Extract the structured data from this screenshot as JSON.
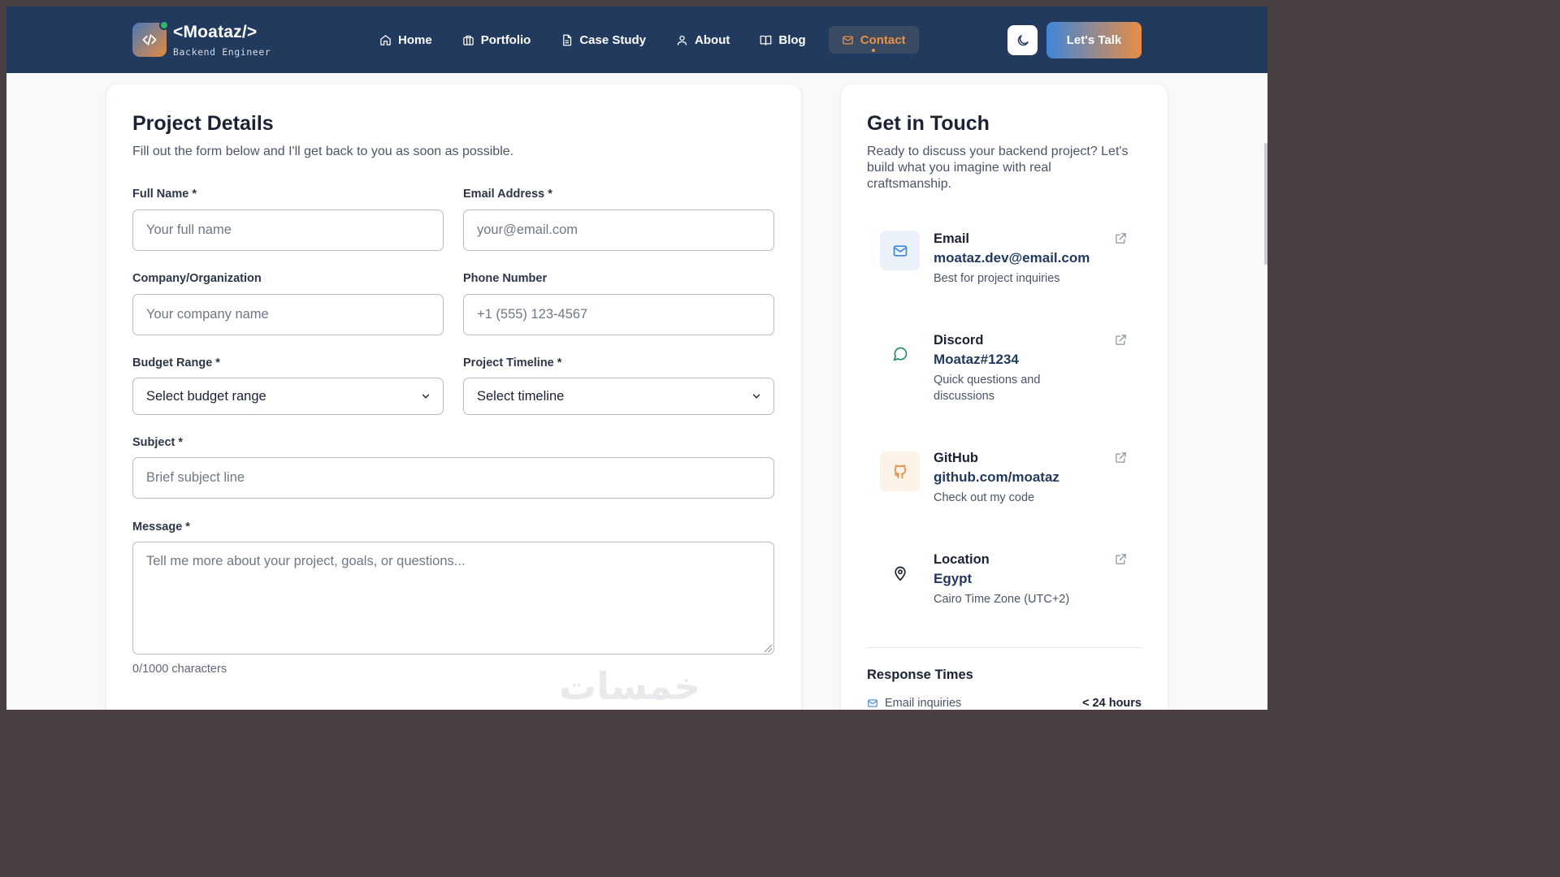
{
  "nav": {
    "logo_title": "<Moataz/>",
    "logo_subtitle": "Backend Engineer",
    "links": [
      {
        "label": "Home",
        "icon": "home-icon"
      },
      {
        "label": "Portfolio",
        "icon": "briefcase-icon"
      },
      {
        "label": "Case Study",
        "icon": "document-icon"
      },
      {
        "label": "About",
        "icon": "user-icon"
      },
      {
        "label": "Blog",
        "icon": "book-icon"
      },
      {
        "label": "Contact",
        "icon": "mail-icon",
        "active": true
      }
    ],
    "cta_label": "Let's Talk",
    "accent": "#e99247",
    "nav_bg": "#223a5e"
  },
  "form": {
    "title": "Project Details",
    "subtitle": "Fill out the form below and I'll get back to you as soon as possible.",
    "full_name_label": "Full Name *",
    "full_name_placeholder": "Your full name",
    "email_label": "Email Address *",
    "email_placeholder": "your@email.com",
    "company_label": "Company/Organization",
    "company_placeholder": "Your company name",
    "phone_label": "Phone Number",
    "phone_placeholder": "+1 (555) 123-4567",
    "budget_label": "Budget Range *",
    "budget_value": "Select budget range",
    "timeline_label": "Project Timeline *",
    "timeline_value": "Select timeline",
    "subject_label": "Subject *",
    "subject_placeholder": "Brief subject line",
    "message_label": "Message *",
    "message_placeholder": "Tell me more about your project, goals, or questions...",
    "counter": "0/1000 characters"
  },
  "touch": {
    "title": "Get in Touch",
    "subtitle": "Ready to discuss your backend project? Let's build what you imagine with real craftsmanship.",
    "items": [
      {
        "title": "Email",
        "value": "moataz.dev@email.com",
        "desc": "Best for project inquiries",
        "icon": "mail-icon"
      },
      {
        "title": "Discord",
        "value": "Moataz#1234",
        "desc": "Quick questions and discussions",
        "icon": "chat-icon"
      },
      {
        "title": "GitHub",
        "value": "github.com/moataz",
        "desc": "Check out my code",
        "icon": "github-icon"
      },
      {
        "title": "Location",
        "value": "Egypt",
        "desc": "Cairo Time Zone (UTC+2)",
        "icon": "location-pin-icon"
      }
    ],
    "response_title": "Response Times",
    "response_rows": [
      {
        "label": "Email inquiries",
        "value": "< 24 hours"
      }
    ]
  },
  "watermark": "خمسات"
}
